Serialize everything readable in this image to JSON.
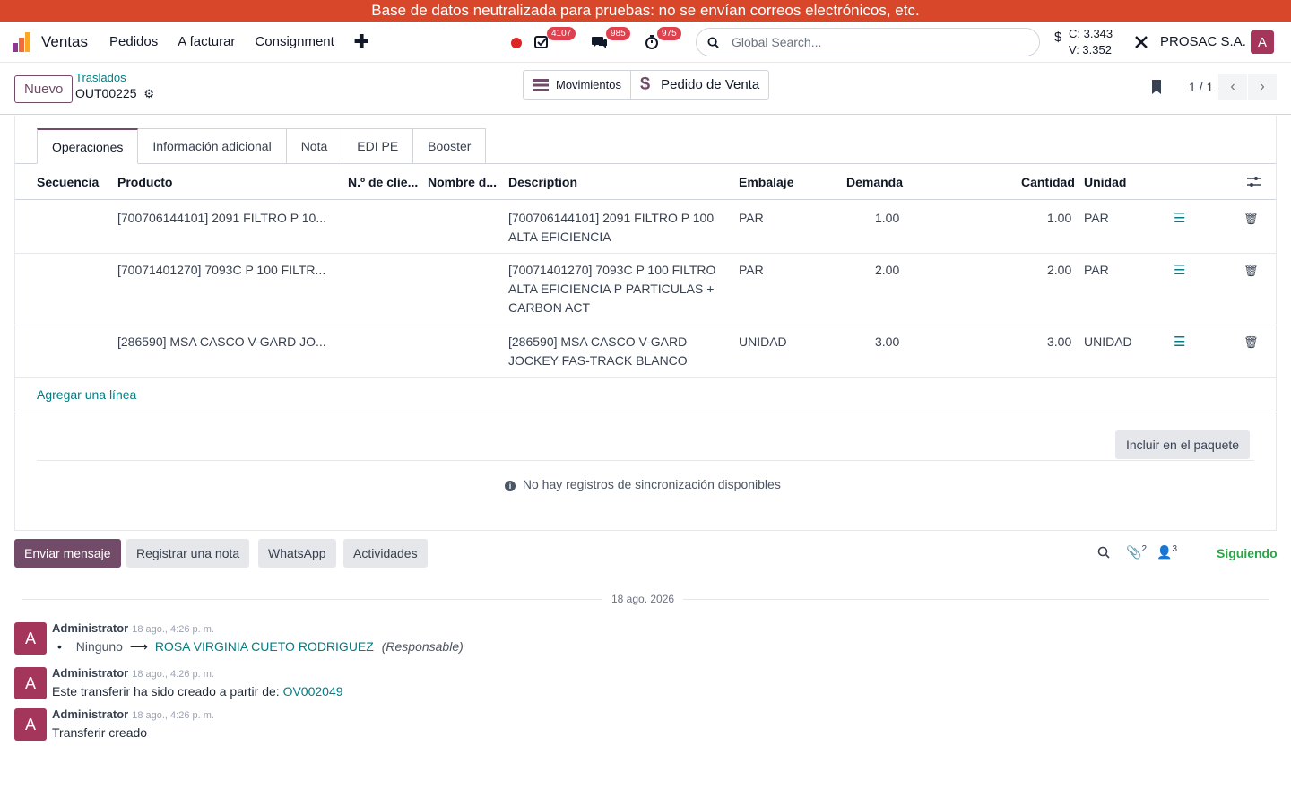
{
  "banner": "Base de datos neutralizada para pruebas: no se envían correos electrónicos, etc.",
  "navbar": {
    "app_name": "Ventas",
    "menu": [
      "Pedidos",
      "A facturar",
      "Consignment"
    ],
    "plus": "✚",
    "badges": {
      "activities": "4107",
      "messages": "985",
      "timers": "975"
    },
    "search_placeholder": "Global Search...",
    "currency": {
      "c": "C: 3.343",
      "v": "V: 3.352"
    },
    "company": "PROSAC S.A.",
    "avatar": "A"
  },
  "control": {
    "new_button": "Nuevo",
    "breadcrumb_parent": "Traslados",
    "breadcrumb_current": "OUT00225",
    "smart_buttons": [
      "Movimientos",
      "Pedido de Venta"
    ],
    "pager": "1 / 1"
  },
  "tabs": [
    "Operaciones",
    "Información adicional",
    "Nota",
    "EDI PE",
    "Booster"
  ],
  "table": {
    "columns": [
      "Secuencia",
      "Producto",
      "N.º de clie...",
      "Nombre d...",
      "Description",
      "Embalaje",
      "Demanda",
      "Cantidad",
      "Unidad"
    ],
    "rows": [
      {
        "product": "[700706144101] 2091 FILTRO P 10...",
        "desc1": "[700706144101] 2091 FILTRO P 100",
        "desc2": "ALTA EFICIENCIA",
        "desc3": "",
        "packaging": "PAR",
        "demand": "1.00",
        "quantity": "1.00",
        "unit": "PAR"
      },
      {
        "product": "[70071401270] 7093C P 100 FILTR...",
        "desc1": "[70071401270] 7093C P 100 FILTRO",
        "desc2": "ALTA EFICIENCIA P PARTICULAS +",
        "desc3": "CARBON ACT",
        "packaging": "PAR",
        "demand": "2.00",
        "quantity": "2.00",
        "unit": "PAR"
      },
      {
        "product": "[286590] MSA CASCO V-GARD JO...",
        "desc1": "[286590] MSA CASCO V-GARD",
        "desc2": "JOCKEY FAS-TRACK BLANCO",
        "desc3": "",
        "packaging": "UNIDAD",
        "demand": "3.00",
        "quantity": "3.00",
        "unit": "UNIDAD"
      }
    ],
    "add_line": "Agregar una línea"
  },
  "include_package": "Incluir en el paquete",
  "no_sync": "No hay registros de sincronización disponibles",
  "chatter": {
    "buttons": [
      "Enviar mensaje",
      "Registrar una nota",
      "WhatsApp",
      "Actividades"
    ],
    "attachments": "2",
    "followers": "3",
    "following": "Siguiendo",
    "date": "18 ago. 2026",
    "messages": [
      {
        "author": "Administrator",
        "time": "18 ago., 4:26 p. m.",
        "old": "Ninguno",
        "new": "ROSA VIRGINIA CUETO RODRIGUEZ",
        "field": "(Responsable)"
      },
      {
        "author": "Administrator",
        "time": "18 ago., 4:26 p. m.",
        "text": "Este transferir ha sido creado a partir de:",
        "link": "OV002049"
      },
      {
        "author": "Administrator",
        "time": "18 ago., 4:26 p. m.",
        "text": "Transferir creado"
      }
    ]
  },
  "colors": {
    "brand": "#714b67",
    "banner": "#d9472b",
    "link": "#017e84",
    "badge": "#e0414e"
  }
}
